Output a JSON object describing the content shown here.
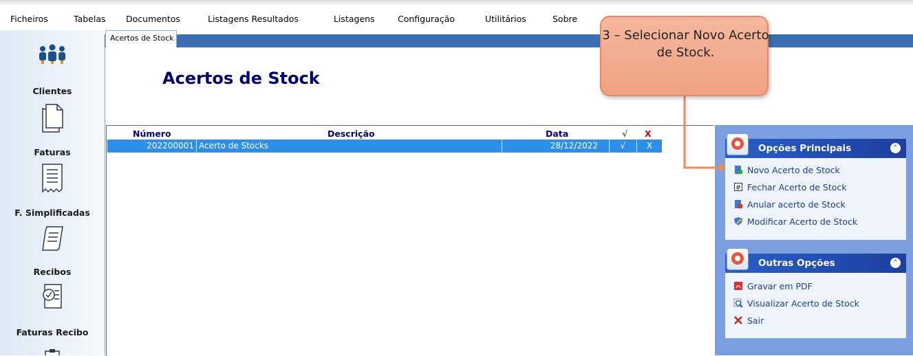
{
  "menu": [
    "Ficheiros",
    "Tabelas",
    "Documentos",
    "Listagens Resultados",
    "Listagens",
    "Configuração",
    "Utilitários",
    "Sobre"
  ],
  "sidebar": {
    "items": [
      {
        "label": "Clientes",
        "icon": "people-icon"
      },
      {
        "label": "Faturas",
        "icon": "document-icon"
      },
      {
        "label": "F. Simplificadas",
        "icon": "receipt-icon"
      },
      {
        "label": "Recibos",
        "icon": "receipt-pen-icon"
      },
      {
        "label": "Faturas Recibo",
        "icon": "invoice-check-icon"
      }
    ]
  },
  "tab": {
    "label": "Acertos de Stock"
  },
  "page": {
    "title": "Acertos de Stock"
  },
  "grid": {
    "headers": {
      "numero": "Número",
      "descricao": "Descrição",
      "data": "Data",
      "ok": "√",
      "x": "X"
    },
    "rows": [
      {
        "numero": "202200001",
        "descricao": "Acerto de Stocks",
        "data": "28/12/2022",
        "ok": "√",
        "x": "X"
      }
    ]
  },
  "panels": {
    "principais": {
      "title": "Opções Principais",
      "collapse": "⌃",
      "links": [
        {
          "label": "Novo Acerto de Stock",
          "icon": "new-document-icon"
        },
        {
          "label": "Fechar Acerto de Stock",
          "icon": "close-document-icon"
        },
        {
          "label": "Anular acerto de Stock",
          "icon": "cancel-document-icon"
        },
        {
          "label": "Modificar Acerto de Stock",
          "icon": "edit-shield-icon"
        }
      ]
    },
    "outras": {
      "title": "Outras Opções",
      "collapse": "⌃",
      "links": [
        {
          "label": "Gravar em PDF",
          "icon": "pdf-icon"
        },
        {
          "label": "Visualizar Acerto de Stock",
          "icon": "magnifier-icon"
        },
        {
          "label": "Sair",
          "icon": "close-x-icon"
        }
      ]
    }
  },
  "callout": {
    "text": "3 – Selecionar Novo Acerto de Stock."
  },
  "colors": {
    "accent": "#2f8fe8",
    "title": "#000070",
    "callout": "#f0a283",
    "panel": "#7b9fe0"
  }
}
